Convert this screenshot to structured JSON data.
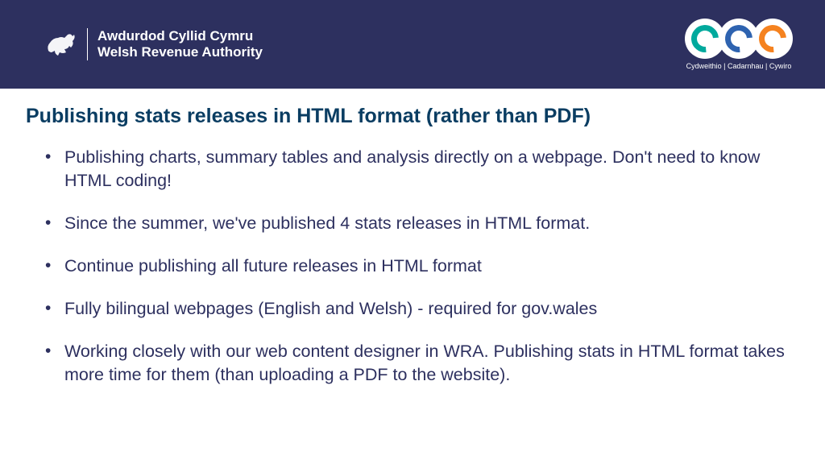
{
  "header": {
    "org_welsh": "Awdurdod Cyllid Cymru",
    "org_english": "Welsh Revenue Authority",
    "tagline": "Cydweithio | Cadarnhau | Cywiro"
  },
  "content": {
    "title": "Publishing stats releases in HTML format (rather than PDF)",
    "bullets": [
      "Publishing charts, summary tables and analysis directly on a webpage. Don't need to know HTML coding!",
      "Since the summer, we've published 4 stats releases in HTML format.",
      "Continue publishing all future releases in HTML format",
      "Fully bilingual webpages (English and Welsh) - required for gov.wales",
      "Working closely with our web content designer in WRA. Publishing stats in HTML format takes more time for them (than uploading a PDF to the website)."
    ]
  }
}
